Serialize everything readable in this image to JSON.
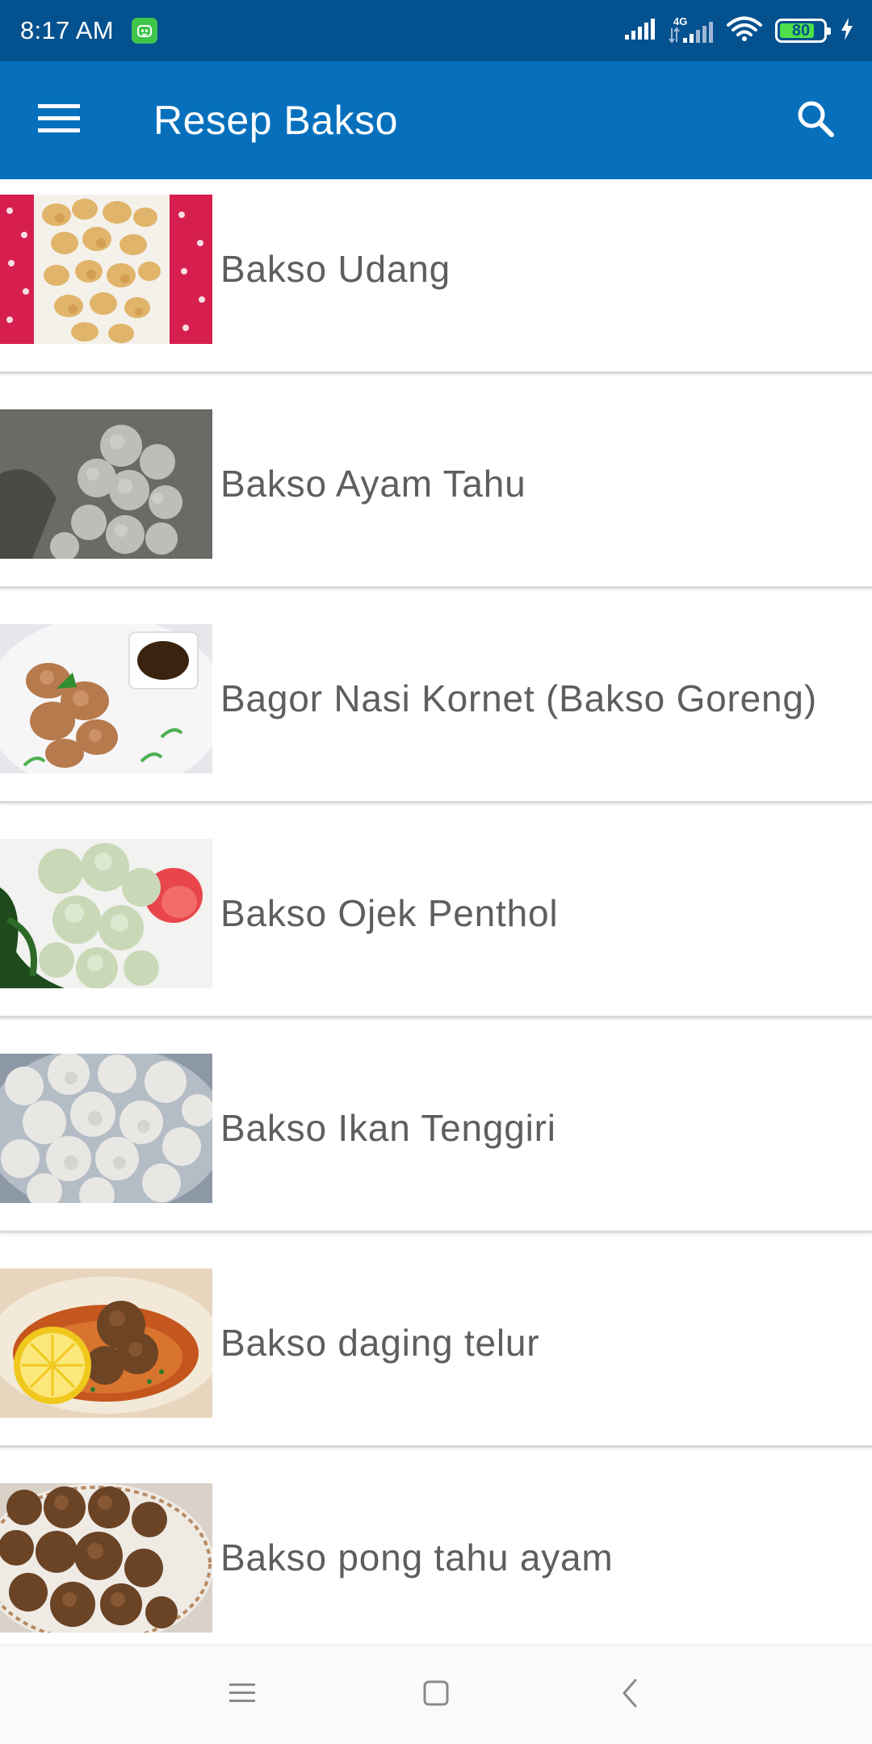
{
  "status_bar": {
    "time": "8:17 AM",
    "network_label": "4G",
    "battery_level": "80",
    "battery_fraction": 0.8,
    "icons": [
      "android-notification-icon",
      "signal-icon",
      "4g-signal-icon",
      "wifi-icon",
      "battery-icon",
      "charging-icon"
    ]
  },
  "app_bar": {
    "title": "Resep Bakso",
    "menu_icon": "menu-icon",
    "search_icon": "search-icon"
  },
  "recipes": [
    {
      "title": "Bakso Udang"
    },
    {
      "title": "Bakso Ayam Tahu"
    },
    {
      "title": "Bagor Nasi Kornet (Bakso Goreng)"
    },
    {
      "title": "Bakso Ojek Penthol"
    },
    {
      "title": "Bakso Ikan Tenggiri"
    },
    {
      "title": "Bakso daging telur"
    },
    {
      "title": "Bakso pong tahu ayam"
    }
  ],
  "nav_bar": {
    "icons": [
      "recents-icon",
      "home-icon",
      "back-icon"
    ]
  },
  "colors": {
    "status_bar": "#04518f",
    "app_bar": "#0670bd",
    "title_text": "#5e5e5e",
    "battery_fill": "#4ee04a"
  }
}
